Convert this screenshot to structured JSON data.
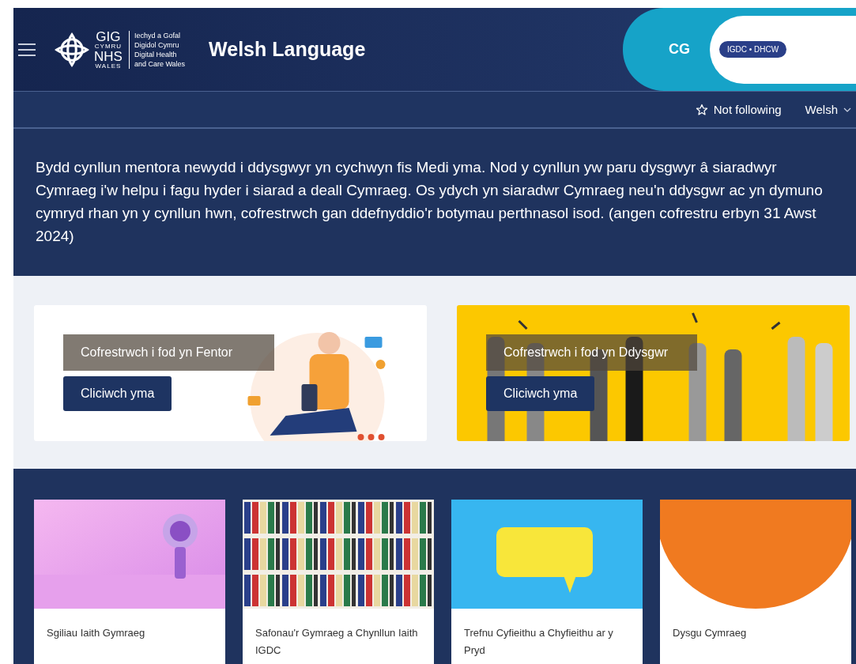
{
  "header": {
    "logo": {
      "mark_lines": [
        "GIG",
        "CYMRU",
        "NHS",
        "WALES"
      ],
      "org_lines": [
        "Iechyd a Gofal",
        "Digidol Cymru",
        "Digital Health",
        "and Care Wales"
      ]
    },
    "title": "Welsh Language",
    "user": {
      "initials": "CG",
      "org_badge": "IGDC • DHCW"
    }
  },
  "subbar": {
    "follow": {
      "label": "Not following",
      "following": false
    },
    "language": {
      "label": "Welsh"
    }
  },
  "announcement": "Bydd cynllun mentora newydd i ddysgwyr yn cychwyn fis Medi yma. Nod y cynllun yw paru dysgwyr â siaradwyr Cymraeg i'w helpu i fagu hyder i siarad a deall Cymraeg. Os ydych yn siaradwr Cymraeg neu'n ddysgwr ac yn dymuno cymryd rhan yn y cynllun hwn, cofrestrwch gan ddefnyddio'r botymau perthnasol isod. (angen cofrestru erbyn 31 Awst 2024)",
  "promos": [
    {
      "kind": "picture",
      "label": "Cofrestrwch i fod yn Fentor",
      "button": "Cliciwch yma"
    },
    {
      "kind": "picture",
      "label": "Cofrestrwch i fod yn Ddysgwr",
      "button": "Cliciwch yma"
    }
  ],
  "tiles": [
    {
      "kind": "picture",
      "title": "Sgiliau Iaith Gymraeg"
    },
    {
      "kind": "picture",
      "title": "Safonau'r Gymraeg a Chynllun Iaith IGDC"
    },
    {
      "kind": "picture",
      "title": "Trefnu Cyfieithu a Chyfieithu ar y Pryd"
    },
    {
      "kind": "picture",
      "title": "Dysgu Cymraeg"
    }
  ]
}
